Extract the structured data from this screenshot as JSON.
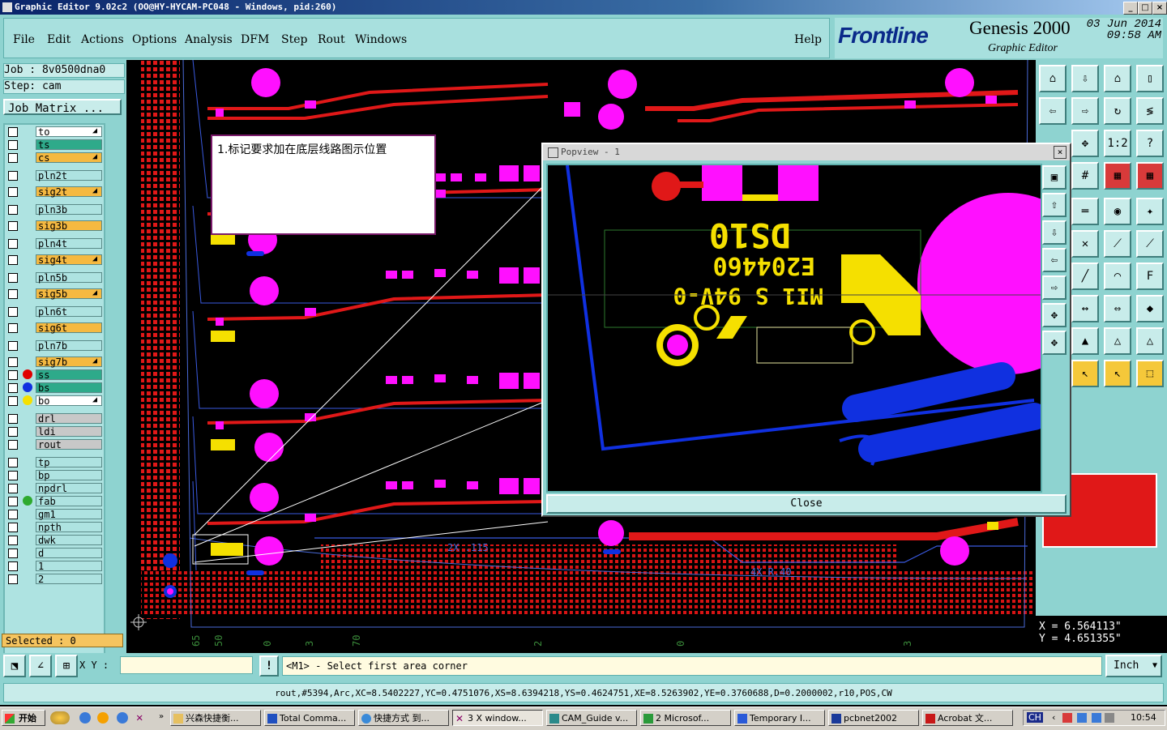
{
  "window": {
    "title": "Graphic Editor 9.02c2 (OO@HY-HYCAM-PC048 - Windows, pid:260)",
    "minimize": "_",
    "maximize": "□",
    "close": "×"
  },
  "menu": [
    "File",
    "Edit",
    "Actions",
    "Options",
    "Analysis",
    "DFM",
    "Step",
    "Rout",
    "Windows"
  ],
  "help": "Help",
  "brand": {
    "logo": "Frontline",
    "product": "Genesis 2000",
    "subtitle": "Graphic Editor",
    "date": "03 Jun 2014",
    "time": "09:58 AM"
  },
  "job": {
    "job_label": "Job : 8v0500dna0",
    "step_label": "Step: cam",
    "matrix_button": "Job Matrix ..."
  },
  "layers": [
    {
      "name": "to",
      "color": "#ffffff",
      "arrow": true
    },
    {
      "name": "ts",
      "color": "#2eaa8a",
      "arrow": false
    },
    {
      "name": "cs",
      "color": "#f5b941",
      "arrow": true
    },
    {
      "name": "pln2t",
      "color": "#aee3e1",
      "arrow": false
    },
    {
      "name": "sig2t",
      "color": "#f5b941",
      "arrow": true
    },
    {
      "name": "pln3b",
      "color": "#aee3e1",
      "arrow": false
    },
    {
      "name": "sig3b",
      "color": "#f5b941",
      "arrow": false
    },
    {
      "name": "pln4t",
      "color": "#aee3e1",
      "arrow": false
    },
    {
      "name": "sig4t",
      "color": "#f5b941",
      "arrow": true
    },
    {
      "name": "pln5b",
      "color": "#aee3e1",
      "arrow": false
    },
    {
      "name": "sig5b",
      "color": "#f5b941",
      "arrow": true
    },
    {
      "name": "pln6t",
      "color": "#aee3e1",
      "arrow": false
    },
    {
      "name": "sig6t",
      "color": "#f5b941",
      "arrow": false
    },
    {
      "name": "pln7b",
      "color": "#aee3e1",
      "arrow": false
    },
    {
      "name": "sig7b",
      "color": "#f5b941",
      "arrow": true
    },
    {
      "name": "ss",
      "color": "#2eaa8a",
      "arrow": false,
      "dot": "#e00000"
    },
    {
      "name": "bs",
      "color": "#2eaa8a",
      "arrow": false,
      "dot": "#1030e0"
    },
    {
      "name": "bo",
      "color": "#ffffff",
      "arrow": true,
      "dot": "#f5e000"
    },
    {
      "name": "drl",
      "color": "#c8c8c8",
      "arrow": false
    },
    {
      "name": "ldi",
      "color": "#c8c8c8",
      "arrow": false
    },
    {
      "name": "rout",
      "color": "#c8c8c8",
      "arrow": false
    },
    {
      "name": "tp",
      "color": "#aee3e1",
      "arrow": false
    },
    {
      "name": "bp",
      "color": "#aee3e1",
      "arrow": false
    },
    {
      "name": "npdrl",
      "color": "#aee3e1",
      "arrow": false
    },
    {
      "name": "fab",
      "color": "#aee3e1",
      "arrow": false,
      "dot": "#2eaa2e"
    },
    {
      "name": "gm1",
      "color": "#aee3e1",
      "arrow": false
    },
    {
      "name": "npth",
      "color": "#aee3e1",
      "arrow": false
    },
    {
      "name": "dwk",
      "color": "#aee3e1",
      "arrow": false
    },
    {
      "name": "d",
      "color": "#aee3e1",
      "arrow": false
    },
    {
      "name": "1",
      "color": "#aee3e1",
      "arrow": false
    },
    {
      "name": "2",
      "color": "#aee3e1",
      "arrow": false
    }
  ],
  "selected": "Selected : 0",
  "note": "1.标记要求加在底层线路图示位置",
  "popview": {
    "title": "Popview - 1",
    "close_button": "Close",
    "marking_line1": "DS10",
    "marking_line2": "E204460",
    "marking_line3": "MI1 S 94V-0"
  },
  "coords": {
    "x": "X = 6.564113\"",
    "y": "Y = 4.651355\""
  },
  "cmd": {
    "xy_label": "X Y :",
    "xy_value": "",
    "prompt": "<M1> - Select first area corner",
    "units": "Inch"
  },
  "message": "rout,#5394,Arc,XC=8.5402227,YC=0.4751076,XS=8.6394218,YS=0.4624751,XE=8.5263902,YE=0.3760688,D=0.2000002,r10,POS,CW",
  "canvas_labels": {
    "dim1": "2X .115",
    "dim2": "4X R.40",
    "ruler": [
      "65",
      "50",
      "0",
      "3",
      "70",
      "2",
      "0",
      "3"
    ]
  },
  "taskbar": {
    "start": "开始",
    "tasks": [
      "兴森快捷衡...",
      "Total Comma...",
      "快捷方式 到...",
      "3 X window...",
      "CAM_Guide v...",
      "2 Microsof...",
      "Temporary I...",
      "pcbnet2002",
      "Acrobat 文..."
    ],
    "lang": "CH",
    "clock": "10:54"
  }
}
